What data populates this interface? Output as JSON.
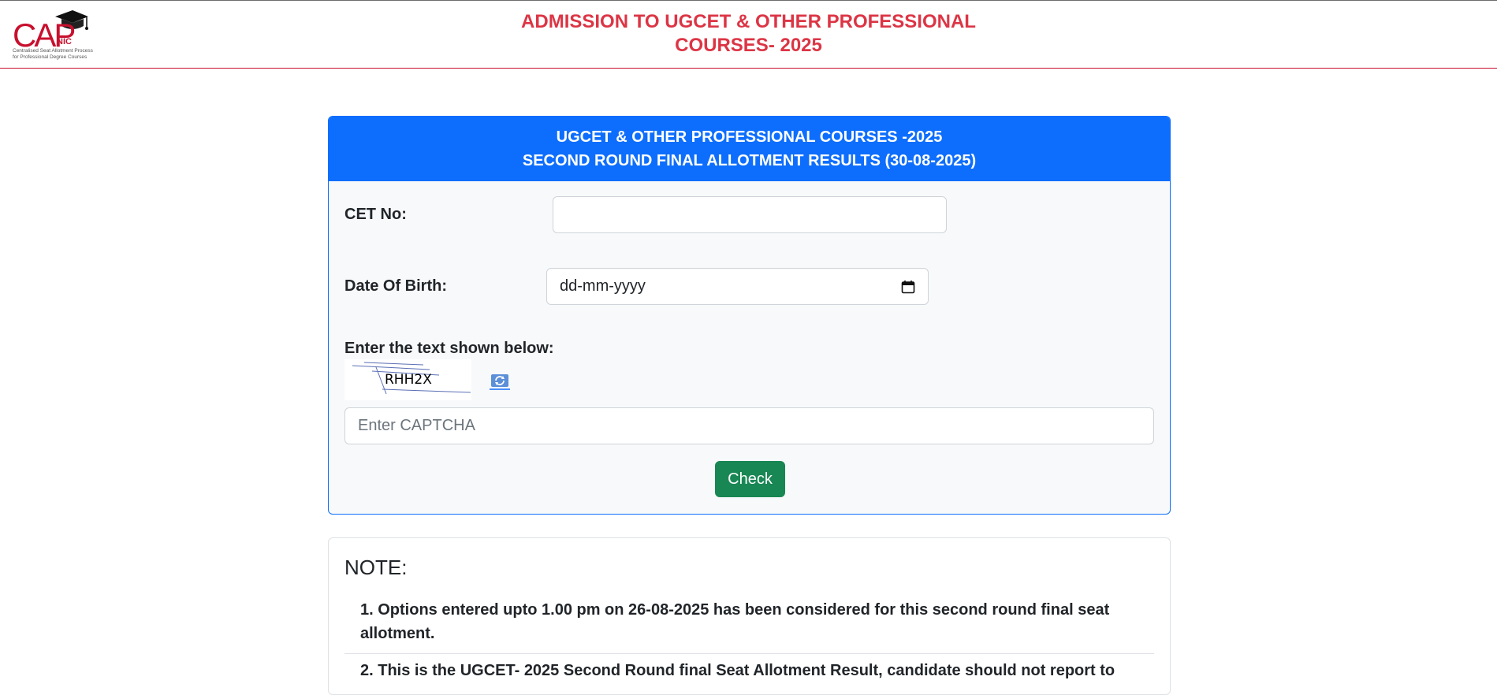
{
  "logo": {
    "text": "CAP",
    "sub": "NIC",
    "tagline_1": "Centralised Seat Allotment Process",
    "tagline_2": "for Professional Degree Courses"
  },
  "banner": {
    "title_line1": "ADMISSION TO UGCET & OTHER PROFESSIONAL",
    "title_line2": "COURSES- 2025"
  },
  "form_card": {
    "header_line1": "UGCET & OTHER PROFESSIONAL COURSES -2025",
    "header_line2": "SECOND ROUND FINAL ALLOTMENT RESULTS (30-08-2025)",
    "cet_label": "CET No:",
    "cet_value": "",
    "dob_label": "Date Of Birth:",
    "dob_placeholder": "dd-mm-yyyy",
    "captcha_label": "Enter the text shown below:",
    "captcha_text": "RHH2X",
    "captcha_placeholder": "Enter CAPTCHA",
    "check_button": "Check"
  },
  "note_card": {
    "title": "NOTE:",
    "items": [
      "1. Options entered upto 1.00 pm on 26-08-2025 has been considered for this second round final seat allotment.",
      "2. This is the UGCET- 2025 Second Round final Seat Allotment Result, candidate should not report to"
    ]
  },
  "colors": {
    "primary": "#0d6efd",
    "success": "#198754",
    "danger": "#dc3545"
  }
}
